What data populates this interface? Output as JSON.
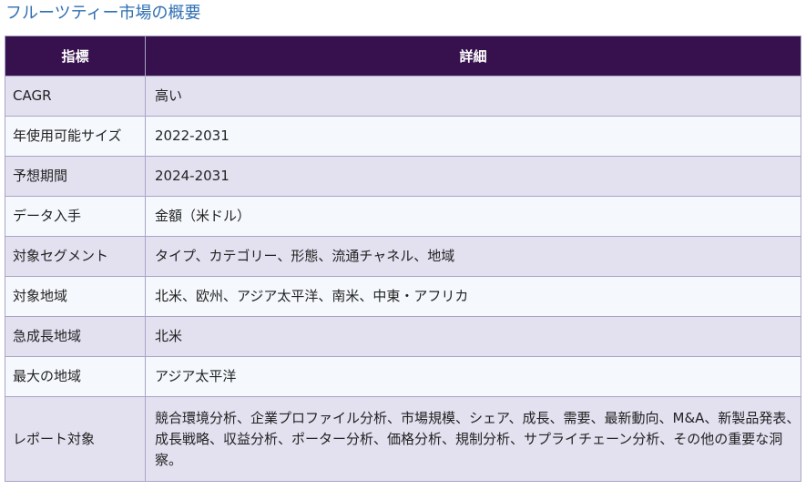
{
  "title": "フルーツティー市場の概要",
  "table": {
    "headers": {
      "metric": "指標",
      "detail": "詳細"
    },
    "rows": [
      {
        "metric": "CAGR",
        "detail": "高い"
      },
      {
        "metric": "年使用可能サイズ",
        "detail": "2022-2031"
      },
      {
        "metric": "予想期間",
        "detail": "2024-2031"
      },
      {
        "metric": "データ入手",
        "detail": "金額（米ドル）"
      },
      {
        "metric": "対象セグメント",
        "detail": "タイプ、カテゴリー、形態、流通チャネル、地域"
      },
      {
        "metric": "対象地域",
        "detail": "北米、欧州、アジア太平洋、南米、中東・アフリカ"
      },
      {
        "metric": "急成長地域",
        "detail": "北米"
      },
      {
        "metric": "最大の地域",
        "detail": "アジア太平洋"
      },
      {
        "metric": "レポート対象",
        "detail": "競合環境分析、企業プロファイル分析、市場規模、シェア、成長、需要、最新動向、M&A、新製品発表、成長戦略、収益分析、ポーター分析、価格分析、規制分析、サプライチェーン分析、その他の重要な洞察。"
      }
    ]
  }
}
